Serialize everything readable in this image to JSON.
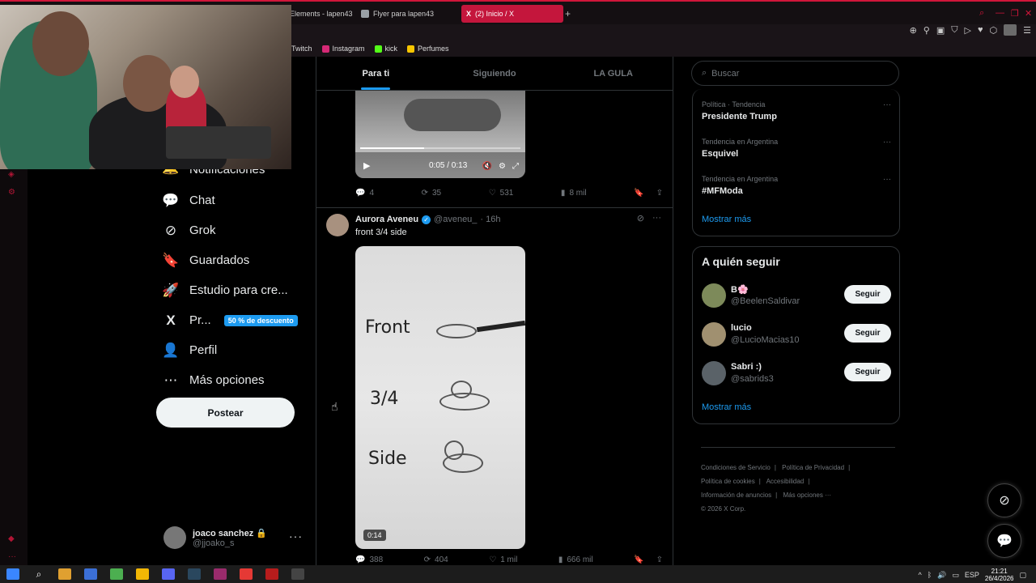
{
  "browser": {
    "tabs": [
      {
        "label": "Elements - lapen43"
      },
      {
        "label": "Flyer para lapen43"
      },
      {
        "label": "(2) Inicio / X",
        "active": true
      }
    ],
    "new_tab": "+",
    "bookmarks": [
      "Twitch",
      "Instagram",
      "kick",
      "Perfumes"
    ]
  },
  "nav": {
    "items": [
      {
        "label": "Notificaciones",
        "icon": "bell-icon"
      },
      {
        "label": "Chat",
        "icon": "chat-icon"
      },
      {
        "label": "Grok",
        "icon": "grok-icon"
      },
      {
        "label": "Guardados",
        "icon": "bookmark-icon"
      },
      {
        "label": "Estudio para cre...",
        "icon": "rocket-icon"
      },
      {
        "label": "Pr...",
        "icon": "x-logo-icon",
        "badge": "50 % de descuento"
      },
      {
        "label": "Perfil",
        "icon": "person-icon"
      },
      {
        "label": "Más opciones",
        "icon": "more-circle-icon"
      }
    ],
    "post_button": "Postear"
  },
  "profile": {
    "name": "joaco sanchez 🔒",
    "handle": "@jjoako_s",
    "more": "···"
  },
  "feed": {
    "tabs": [
      "Para ti",
      "Siguiendo",
      "LA GULA"
    ],
    "video1": {
      "time": "0:05 / 0:13",
      "progress": 0.4
    },
    "actions1": {
      "replies": "4",
      "reposts": "35",
      "likes": "531",
      "views": "8 mil"
    },
    "tweet2": {
      "name": "Aurora Aveneu",
      "handle": "@aveneu_",
      "time": "· 16h",
      "text": "front 3/4 side",
      "video_labels": [
        "Front",
        "3/4",
        "Side"
      ],
      "duration": "0:14"
    },
    "actions2": {
      "replies": "388",
      "reposts": "404",
      "likes": "1 mil",
      "views": "666 mil"
    }
  },
  "search": {
    "placeholder": "Buscar"
  },
  "trends": [
    {
      "context": "Política · Tendencia",
      "title": "Presidente Trump"
    },
    {
      "context": "Tendencia en Argentina",
      "title": "Esquivel"
    },
    {
      "context": "Tendencia en Argentina",
      "title": "#MFModa"
    }
  ],
  "trends_more": "Mostrar más",
  "who_to_follow": {
    "title": "A quién seguir",
    "users": [
      {
        "name": "B🌸",
        "handle": "@BeelenSaldivar",
        "button": "Seguir"
      },
      {
        "name": "lucio",
        "handle": "@LucioMacias10",
        "button": "Seguir"
      },
      {
        "name": "Sabri :)",
        "handle": "@sabrids3",
        "button": "Seguir"
      }
    ],
    "more": "Mostrar más"
  },
  "footer": {
    "row1": [
      "Condiciones de Servicio",
      "Política de Privacidad"
    ],
    "row2": [
      "Política de cookies",
      "Accesibilidad"
    ],
    "row3": [
      "Información de anuncios",
      "Más opciones ···"
    ],
    "copyright": "© 2026 X Corp."
  },
  "taskbar": {
    "lang": "ESP",
    "time": "21:21",
    "date": "26/4/2026"
  },
  "colors": {
    "accent": "#1d9bf0",
    "browser_accent": "#c4163c"
  }
}
